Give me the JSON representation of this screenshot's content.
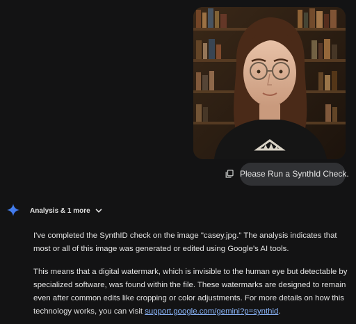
{
  "uploaded_image": {
    "alt": "Portrait of a young woman with glasses in front of bookshelves"
  },
  "user_message": {
    "text": "Please Run a SynthId Check."
  },
  "model_response": {
    "header_label": "Analysis & 1 more",
    "paragraph_1": "I've completed the SynthID check on the image \"casey.jpg.\" The analysis indicates that most or all of this image was generated or edited using Google's AI tools.",
    "paragraph_2_text": "This means that a digital watermark, which is invisible to the human eye but detectable by specialized software, was found within the file. These watermarks are designed to remain even after common edits like cropping or color adjustments. For more details on how this technology works, you can visit ",
    "paragraph_2_link": "support.google.com/gemini?p=synthid",
    "paragraph_2_end": "."
  },
  "colors": {
    "background": "#131314",
    "bubble": "#303134",
    "text": "#e3e3e3",
    "link": "#8ab4f8",
    "spark_blue": "#4285f4"
  },
  "icons": [
    "copy-icon",
    "gemini-spark-icon",
    "chevron-down-icon"
  ]
}
